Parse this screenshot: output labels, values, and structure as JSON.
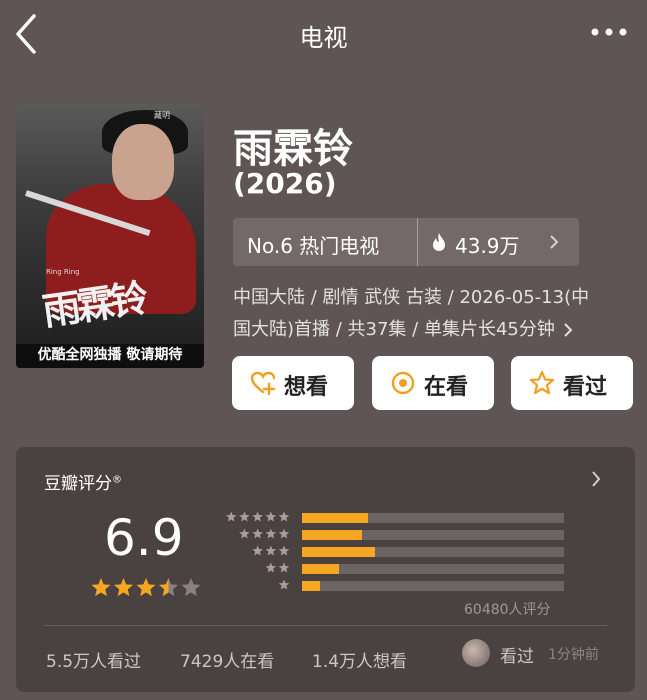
{
  "nav": {
    "title": "电视"
  },
  "poster": {
    "calligraphy": "雨霖铃",
    "tagline": "优酷全网独播  敬请期待",
    "small_text": "Ring Ring",
    "watermark": "藏明"
  },
  "show": {
    "title": "雨霖铃",
    "year": "(2026)"
  },
  "rank": {
    "label": "No.6 热门电视",
    "heat": "43.9万"
  },
  "meta": {
    "line1": "中国大陆 / 剧情 武侠 古装 / 2026-05-13(中",
    "line2": "国大陆)首播 / 共37集 / 单集片长45分钟"
  },
  "actions": {
    "want": "想看",
    "watching": "在看",
    "watched": "看过"
  },
  "rating": {
    "title": "豆瓣评分",
    "title_mark": "®",
    "score": "6.9",
    "stars_value": 3.5,
    "stars_max": 5,
    "distribution": [
      {
        "stars": 5,
        "fraction": 0.25
      },
      {
        "stars": 4,
        "fraction": 0.23
      },
      {
        "stars": 3,
        "fraction": 0.28
      },
      {
        "stars": 2,
        "fraction": 0.14
      },
      {
        "stars": 1,
        "fraction": 0.07
      }
    ],
    "count": "60480人评分"
  },
  "stats": {
    "watched": "5.5万人看过",
    "watching": "7429人在看",
    "want": "1.4万人想看"
  },
  "friend": {
    "action": "看过",
    "time": "1分钟前"
  },
  "colors": {
    "background": "#5f5554",
    "card": "#4a4241",
    "accent": "#f6a623"
  },
  "icons": {
    "back": "chevron-left-icon",
    "more": "more-dots-icon",
    "heat": "flame-icon",
    "want": "heart-plus-icon",
    "watching": "target-icon",
    "watched": "star-icon"
  }
}
